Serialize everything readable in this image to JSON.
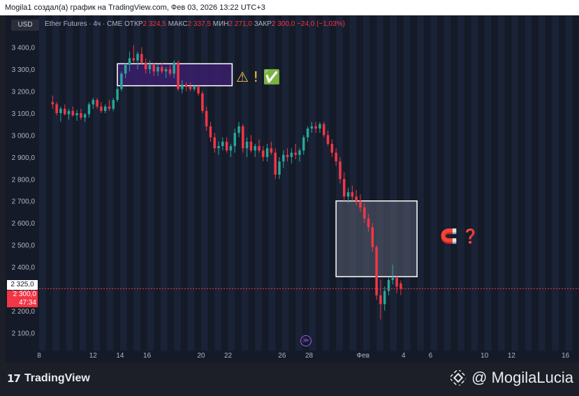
{
  "header": {
    "text": "Mogila1 создал(а) график на TradingView.com, Фев 03, 2026 13:22 UTC+3"
  },
  "toolbar": {
    "currency": "USD"
  },
  "legend": {
    "symbol": "Ether Futures · 4ч · CME",
    "open_label": "ОТКР",
    "open": "2 324,5",
    "high_label": "МАКС",
    "high": "2 337,5",
    "low_label": "МИН",
    "low": "2 271,0",
    "close_label": "ЗАКР",
    "close": "2 300,0",
    "change": "−24,0 (−1,03%)"
  },
  "price_labels": {
    "prev": "2 325,0",
    "last": "2 300,0",
    "countdown": "47:34"
  },
  "annotations": {
    "upper_marks": "⚠ ! ✅",
    "lower_marks": "🧲 ❓"
  },
  "footer": {
    "brand": "TradingView",
    "watermark": "@ MogilaLucia"
  },
  "colors": {
    "up": "#26a69a",
    "down": "#f23645",
    "bg": "#151a28",
    "zone_top": "#3b1f6b",
    "zone_bottom": "#5a5f70"
  },
  "chart_data": {
    "type": "candlestick",
    "ylim": [
      2050,
      3450
    ],
    "y_ticks": [
      "3 400,0",
      "3 300,0",
      "3 200,0",
      "3 100,0",
      "3 000,0",
      "2 900,0",
      "2 800,0",
      "2 700,0",
      "2 600,0",
      "2 500,0",
      "2 400,0",
      "2 300,0",
      "2 200,0",
      "2 100,0"
    ],
    "y_tick_values": [
      3400,
      3300,
      3200,
      3100,
      3000,
      2900,
      2800,
      2700,
      2600,
      2500,
      2400,
      2300,
      2200,
      2100
    ],
    "x_ticks": [
      "8",
      "12",
      "14",
      "16",
      "20",
      "22",
      "26",
      "28",
      "Фев",
      "4",
      "6",
      "10",
      "12",
      "16"
    ],
    "x_tick_days": [
      8,
      12,
      14,
      16,
      20,
      22,
      26,
      28,
      32,
      35,
      37,
      41,
      43,
      47
    ],
    "x_range_days": [
      8,
      48
    ],
    "candles": [
      [
        9.0,
        3150,
        3180,
        3120,
        3140
      ],
      [
        9.3,
        3140,
        3150,
        3090,
        3100
      ],
      [
        9.6,
        3100,
        3130,
        3060,
        3120
      ],
      [
        9.9,
        3120,
        3140,
        3090,
        3095
      ],
      [
        10.2,
        3095,
        3120,
        3070,
        3110
      ],
      [
        10.5,
        3110,
        3130,
        3085,
        3090
      ],
      [
        10.8,
        3090,
        3115,
        3065,
        3100
      ],
      [
        11.1,
        3100,
        3120,
        3070,
        3080
      ],
      [
        11.4,
        3080,
        3100,
        3060,
        3095
      ],
      [
        11.7,
        3095,
        3150,
        3080,
        3140
      ],
      [
        12.0,
        3140,
        3170,
        3120,
        3160
      ],
      [
        12.3,
        3160,
        3170,
        3120,
        3130
      ],
      [
        12.6,
        3130,
        3150,
        3100,
        3110
      ],
      [
        12.9,
        3110,
        3140,
        3100,
        3130
      ],
      [
        13.2,
        3130,
        3160,
        3110,
        3120
      ],
      [
        13.5,
        3120,
        3170,
        3110,
        3160
      ],
      [
        13.8,
        3160,
        3220,
        3150,
        3210
      ],
      [
        14.1,
        3210,
        3290,
        3200,
        3280
      ],
      [
        14.4,
        3280,
        3330,
        3260,
        3320
      ],
      [
        14.7,
        3320,
        3380,
        3290,
        3350
      ],
      [
        15.0,
        3350,
        3410,
        3330,
        3340
      ],
      [
        15.3,
        3340,
        3380,
        3300,
        3370
      ],
      [
        15.6,
        3370,
        3400,
        3320,
        3330
      ],
      [
        15.9,
        3330,
        3350,
        3280,
        3300
      ],
      [
        16.2,
        3300,
        3340,
        3280,
        3320
      ],
      [
        16.5,
        3320,
        3330,
        3270,
        3290
      ],
      [
        16.8,
        3290,
        3320,
        3270,
        3310
      ],
      [
        17.1,
        3310,
        3330,
        3280,
        3290
      ],
      [
        17.4,
        3290,
        3310,
        3260,
        3300
      ],
      [
        17.7,
        3300,
        3320,
        3270,
        3280
      ],
      [
        18.0,
        3280,
        3340,
        3260,
        3330
      ],
      [
        18.3,
        3330,
        3340,
        3200,
        3210
      ],
      [
        18.6,
        3210,
        3250,
        3190,
        3230
      ],
      [
        18.9,
        3230,
        3240,
        3200,
        3220
      ],
      [
        19.2,
        3220,
        3240,
        3200,
        3210
      ],
      [
        19.5,
        3210,
        3230,
        3200,
        3220
      ],
      [
        19.8,
        3220,
        3230,
        3180,
        3190
      ],
      [
        20.1,
        3190,
        3200,
        3100,
        3110
      ],
      [
        20.4,
        3110,
        3130,
        3020,
        3040
      ],
      [
        20.7,
        3040,
        3060,
        2970,
        2990
      ],
      [
        21.0,
        2990,
        3010,
        2920,
        2940
      ],
      [
        21.3,
        2940,
        2970,
        2910,
        2950
      ],
      [
        21.6,
        2950,
        2990,
        2930,
        2970
      ],
      [
        21.9,
        2970,
        2990,
        2920,
        2930
      ],
      [
        22.2,
        2930,
        2960,
        2900,
        2950
      ],
      [
        22.5,
        2950,
        3030,
        2920,
        3010
      ],
      [
        22.8,
        3010,
        3060,
        2990,
        3040
      ],
      [
        23.1,
        3040,
        3050,
        2920,
        2940
      ],
      [
        23.4,
        2940,
        2990,
        2900,
        2970
      ],
      [
        23.7,
        2970,
        3000,
        2920,
        2930
      ],
      [
        24.0,
        2930,
        2960,
        2900,
        2950
      ],
      [
        24.3,
        2950,
        2980,
        2920,
        2930
      ],
      [
        24.6,
        2930,
        2950,
        2880,
        2900
      ],
      [
        24.9,
        2900,
        2960,
        2880,
        2940
      ],
      [
        25.2,
        2940,
        2970,
        2910,
        2920
      ],
      [
        25.5,
        2920,
        2940,
        2800,
        2820
      ],
      [
        25.8,
        2820,
        2900,
        2800,
        2880
      ],
      [
        26.1,
        2880,
        2930,
        2850,
        2910
      ],
      [
        26.4,
        2910,
        2940,
        2880,
        2900
      ],
      [
        26.7,
        2900,
        2940,
        2870,
        2920
      ],
      [
        27.0,
        2920,
        2960,
        2890,
        2910
      ],
      [
        27.3,
        2910,
        2940,
        2880,
        2930
      ],
      [
        27.6,
        2930,
        3000,
        2910,
        2990
      ],
      [
        27.9,
        2990,
        3040,
        2970,
        3030
      ],
      [
        28.2,
        3030,
        3060,
        3010,
        3040
      ],
      [
        28.5,
        3040,
        3060,
        3010,
        3030
      ],
      [
        28.8,
        3030,
        3060,
        3010,
        3050
      ],
      [
        29.1,
        3050,
        3060,
        2990,
        3000
      ],
      [
        29.4,
        3000,
        3020,
        2950,
        2960
      ],
      [
        29.7,
        2960,
        2980,
        2900,
        2920
      ],
      [
        30.0,
        2920,
        2940,
        2860,
        2880
      ],
      [
        30.3,
        2880,
        2900,
        2780,
        2800
      ],
      [
        30.6,
        2800,
        2830,
        2700,
        2720
      ],
      [
        30.9,
        2720,
        2760,
        2690,
        2740
      ],
      [
        31.2,
        2740,
        2770,
        2700,
        2720
      ],
      [
        31.5,
        2720,
        2750,
        2680,
        2700
      ],
      [
        31.8,
        2700,
        2730,
        2650,
        2670
      ],
      [
        32.1,
        2670,
        2690,
        2600,
        2620
      ],
      [
        32.4,
        2620,
        2640,
        2560,
        2580
      ],
      [
        32.7,
        2580,
        2600,
        2470,
        2490
      ],
      [
        33.0,
        2490,
        2500,
        2250,
        2270
      ],
      [
        33.3,
        2270,
        2340,
        2160,
        2230
      ],
      [
        33.6,
        2230,
        2310,
        2200,
        2290
      ],
      [
        33.9,
        2290,
        2350,
        2270,
        2340
      ],
      [
        34.2,
        2340,
        2410,
        2320,
        2350
      ],
      [
        34.5,
        2350,
        2360,
        2280,
        2310
      ],
      [
        34.8,
        2324.5,
        2337.5,
        2271,
        2300
      ]
    ],
    "zones": [
      {
        "from_day": 13.8,
        "to_day": 22.3,
        "top": 3325,
        "bottom": 3225
      },
      {
        "from_day": 30.0,
        "to_day": 36.0,
        "top": 2700,
        "bottom": 2355
      }
    ]
  }
}
